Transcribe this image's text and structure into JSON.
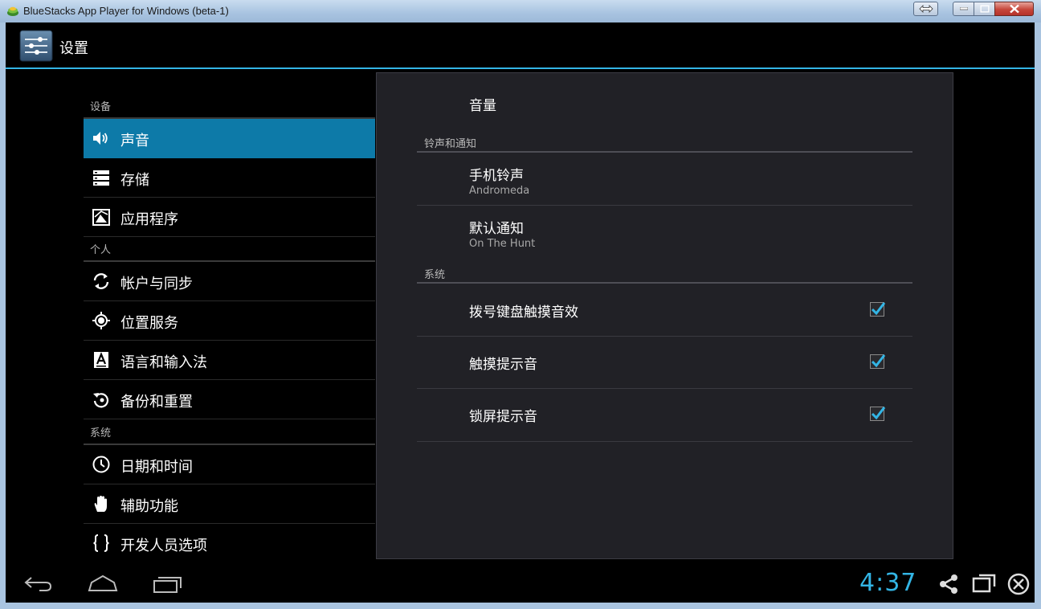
{
  "window": {
    "title": "BlueStacks App Player for Windows (beta-1)"
  },
  "action_bar": {
    "title": "设置"
  },
  "left_list": {
    "sections": [
      {
        "header": "设备",
        "items": [
          {
            "label": "声音",
            "icon": "speaker-icon",
            "active": true
          },
          {
            "label": "存储",
            "icon": "storage-icon"
          },
          {
            "label": "应用程序",
            "icon": "apps-icon"
          }
        ]
      },
      {
        "header": "个人",
        "items": [
          {
            "label": "帐户与同步",
            "icon": "sync-icon"
          },
          {
            "label": "位置服务",
            "icon": "location-icon"
          },
          {
            "label": "语言和输入法",
            "icon": "language-icon"
          },
          {
            "label": "备份和重置",
            "icon": "backup-icon"
          }
        ]
      },
      {
        "header": "系统",
        "items": [
          {
            "label": "日期和时间",
            "icon": "clock-icon"
          },
          {
            "label": "辅助功能",
            "icon": "hand-icon"
          },
          {
            "label": "开发人员选项",
            "icon": "braces-icon"
          }
        ]
      }
    ]
  },
  "detail": {
    "title": "音量",
    "sections": [
      {
        "header": "铃声和通知",
        "items": [
          {
            "title": "手机铃声",
            "summary": "Andromeda"
          },
          {
            "title": "默认通知",
            "summary": "On The Hunt"
          }
        ]
      },
      {
        "header": "系统",
        "items": [
          {
            "title": "拨号键盘触摸音效",
            "checked": true
          },
          {
            "title": "触摸提示音",
            "checked": true
          },
          {
            "title": "锁屏提示音",
            "checked": true
          }
        ]
      }
    ]
  },
  "status_bar": {
    "time": "4:37"
  },
  "colors": {
    "accent": "#33b5e5",
    "selected": "#0d7aa8",
    "pane": "#212126"
  }
}
